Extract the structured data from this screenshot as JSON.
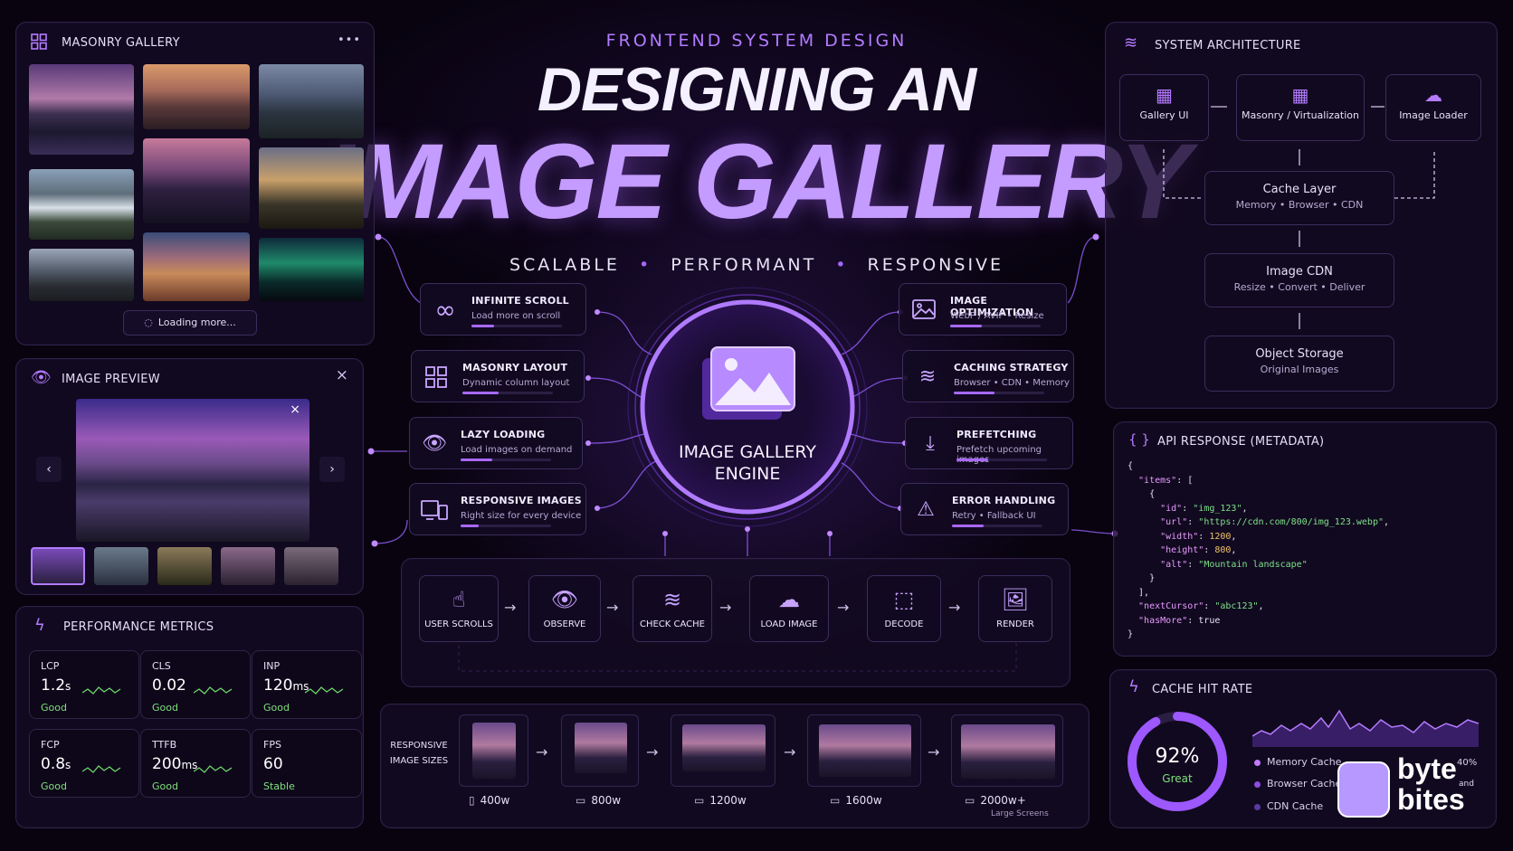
{
  "header": {
    "kicker": "FRONTEND SYSTEM DESIGN",
    "title_line1": "DESIGNING AN",
    "title_line2": "IMAGE GALLERY",
    "tagline": [
      "SCALABLE",
      "PERFORMANT",
      "RESPONSIVE"
    ]
  },
  "masonry": {
    "title": "MASONRY GALLERY",
    "menu": "•••",
    "loading": "Loading more..."
  },
  "preview": {
    "title": "IMAGE PREVIEW",
    "close": "×"
  },
  "metrics": {
    "title": "PERFORMANCE METRICS",
    "items": [
      {
        "label": "LCP",
        "value": "1.2",
        "unit": "s",
        "status": "Good"
      },
      {
        "label": "CLS",
        "value": "0.02",
        "unit": "",
        "status": "Good"
      },
      {
        "label": "INP",
        "value": "120",
        "unit": "ms",
        "status": "Good"
      },
      {
        "label": "FCP",
        "value": "0.8",
        "unit": "s",
        "status": "Good"
      },
      {
        "label": "TTFB",
        "value": "200",
        "unit": "ms",
        "status": "Good"
      },
      {
        "label": "FPS",
        "value": "60",
        "unit": "",
        "status": "Stable"
      }
    ]
  },
  "engine": {
    "label_line1": "IMAGE GALLERY",
    "label_line2": "ENGINE"
  },
  "features_left": [
    {
      "title": "INFINITE SCROLL",
      "sub": "Load more on scroll",
      "icon": "infinity-icon",
      "progress": 0.25
    },
    {
      "title": "MASONRY LAYOUT",
      "sub": "Dynamic column layout",
      "icon": "grid-icon",
      "progress": 0.4
    },
    {
      "title": "LAZY LOADING",
      "sub": "Load images on demand",
      "icon": "eye-icon",
      "progress": 0.35
    },
    {
      "title": "RESPONSIVE IMAGES",
      "sub": "Right size for every device",
      "icon": "devices-icon",
      "progress": 0.2
    }
  ],
  "features_right": [
    {
      "title": "IMAGE OPTIMIZATION",
      "sub": "WebP / AVIF • Resize",
      "icon": "image-icon",
      "progress": 0.35
    },
    {
      "title": "CACHING STRATEGY",
      "sub": "Browser • CDN • Memory",
      "icon": "layers-icon",
      "progress": 0.45
    },
    {
      "title": "PREFETCHING",
      "sub": "Prefetch upcoming images",
      "icon": "download-icon",
      "progress": 0.35
    },
    {
      "title": "ERROR HANDLING",
      "sub": "Retry • Fallback UI",
      "icon": "warning-icon",
      "progress": 0.35
    }
  ],
  "pipeline": [
    {
      "label": "USER SCROLLS",
      "icon": "pointer-icon"
    },
    {
      "label": "OBSERVE",
      "icon": "eye-icon"
    },
    {
      "label": "CHECK CACHE",
      "icon": "layers-icon"
    },
    {
      "label": "LOAD IMAGE",
      "icon": "cloud-download-icon"
    },
    {
      "label": "DECODE",
      "icon": "dashed-square-icon"
    },
    {
      "label": "RENDER",
      "icon": "image-icon"
    }
  ],
  "responsive": {
    "label_line1": "RESPONSIVE",
    "label_line2": "IMAGE SIZES",
    "sizes": [
      {
        "label": "400w",
        "note": ""
      },
      {
        "label": "800w",
        "note": ""
      },
      {
        "label": "1200w",
        "note": ""
      },
      {
        "label": "1600w",
        "note": ""
      },
      {
        "label": "2000w+",
        "note": "Large Screens"
      }
    ]
  },
  "architecture": {
    "title": "SYSTEM ARCHITECTURE",
    "top": [
      "Gallery UI",
      "Masonry / Virtualization",
      "Image Loader"
    ],
    "cache": {
      "title": "Cache Layer",
      "sub": "Memory • Browser • CDN"
    },
    "cdn": {
      "title": "Image CDN",
      "sub": "Resize • Convert • Deliver"
    },
    "storage": {
      "title": "Object Storage",
      "sub": "Original Images"
    }
  },
  "api": {
    "title": "API RESPONSE (METADATA)",
    "braces": "{ }",
    "item": {
      "id": "img_123",
      "url": "https://cdn.com/800/img_123.webp",
      "width": 1200,
      "height": 800,
      "alt": "Mountain landscape"
    },
    "nextCursor": "abc123",
    "hasMore": "true"
  },
  "cache_rate": {
    "title": "CACHE HIT RATE",
    "value": 0.92,
    "value_text": "92%",
    "status": "Great",
    "side_pct": "40%",
    "legend": [
      "Memory Cache",
      "Browser Cache",
      "CDN Cache"
    ]
  },
  "brand": {
    "line1": "byte",
    "line2": "bites",
    "and": "and"
  },
  "colors": {
    "accent": "#a45cff",
    "good": "#7fe07c",
    "bg": "#08030f"
  }
}
